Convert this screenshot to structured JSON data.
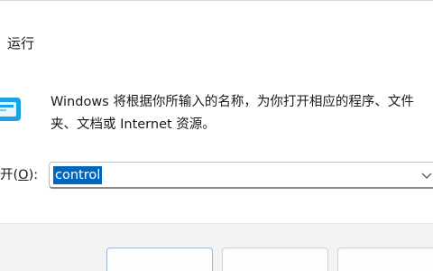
{
  "window": {
    "title": "运行"
  },
  "dialog": {
    "description": "Windows 将根据你所输入的名称，为你打开相应的程序、文件夹、文档或 Internet 资源。",
    "open_label_prefix": "开(",
    "open_label_mnemonic": "O",
    "open_label_suffix": "):",
    "input_value": "control"
  },
  "footer": {
    "buttons": [
      "ok",
      "cancel",
      "browse"
    ]
  },
  "colors": {
    "selection": "#0067c0",
    "icon_blue": "#1aa3e8",
    "footer_bg": "#f3f3f3"
  },
  "icons": {
    "app": "run-app-icon",
    "dropdown": "chevron-down-icon"
  }
}
